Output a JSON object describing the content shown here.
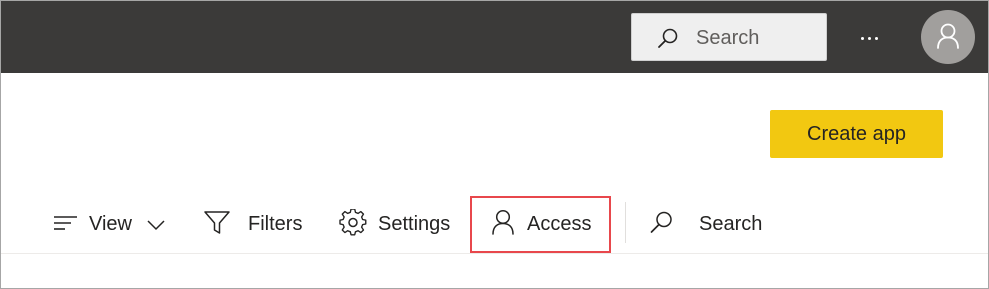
{
  "header": {
    "search_placeholder": "Search",
    "more_label": "...",
    "background_color": "#3b3a39"
  },
  "actions": {
    "create_app_label": "Create app",
    "accent_color": "#f2c811"
  },
  "toolbar": {
    "view_label": "View",
    "filters_label": "Filters",
    "settings_label": "Settings",
    "access_label": "Access",
    "search_label": "Search",
    "highlight_color": "#e8474c"
  },
  "icons": {
    "header_search": "search-icon",
    "more": "more-icon",
    "avatar": "person-icon",
    "view": "list-icon",
    "view_dropdown": "chevron-down-icon",
    "filters": "filter-icon",
    "settings": "gear-icon",
    "access": "person-icon",
    "toolbar_search": "search-icon"
  }
}
